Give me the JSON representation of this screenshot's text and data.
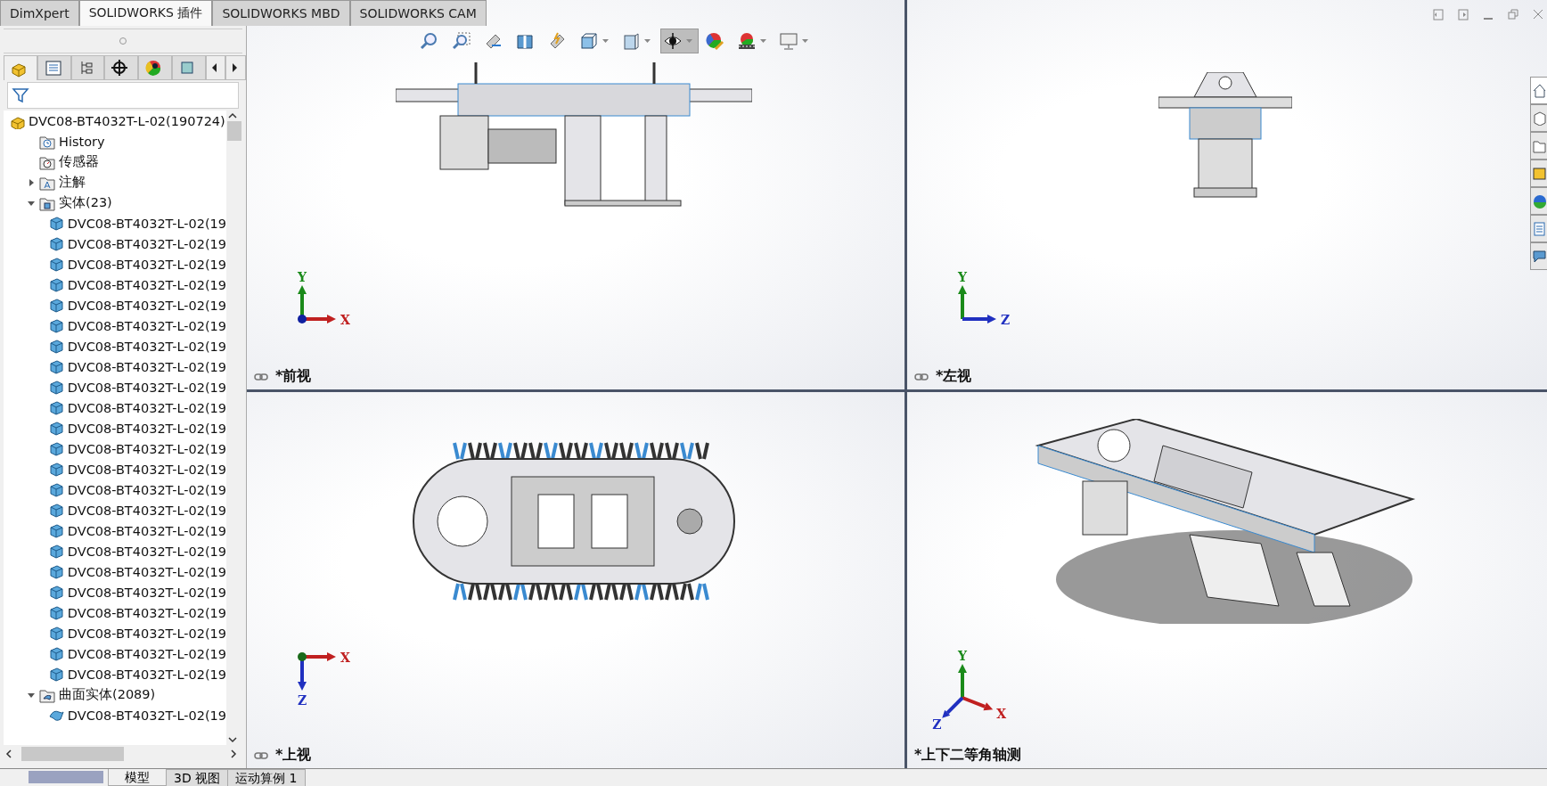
{
  "ribbon_tabs": [
    {
      "label": "DimXpert",
      "selected": false
    },
    {
      "label": "SOLIDWORKS 插件",
      "selected": true
    },
    {
      "label": "SOLIDWORKS MBD",
      "selected": false
    },
    {
      "label": "SOLIDWORKS CAM",
      "selected": false
    }
  ],
  "panel_tabs": [
    {
      "kind": "feature",
      "selected": true
    },
    {
      "kind": "property",
      "selected": false
    },
    {
      "kind": "config",
      "selected": false
    },
    {
      "kind": "dimxpert",
      "selected": false
    },
    {
      "kind": "appearance",
      "selected": false
    },
    {
      "kind": "cam",
      "selected": false
    }
  ],
  "tree": {
    "label": "DVC08-BT4032T-L-02(190724)",
    "children": [
      {
        "kind": "history",
        "label": "History"
      },
      {
        "kind": "sensor",
        "label": "传感器"
      },
      {
        "kind": "annotation",
        "label": "注解",
        "expanded": false
      },
      {
        "kind": "folder",
        "label": "实体(23)",
        "expanded": true,
        "children": [
          {
            "kind": "solid",
            "label": "DVC08-BT4032T-L-02(19"
          },
          {
            "kind": "solid",
            "label": "DVC08-BT4032T-L-02(19"
          },
          {
            "kind": "solid",
            "label": "DVC08-BT4032T-L-02(19"
          },
          {
            "kind": "solid",
            "label": "DVC08-BT4032T-L-02(19"
          },
          {
            "kind": "solid",
            "label": "DVC08-BT4032T-L-02(19"
          },
          {
            "kind": "solid",
            "label": "DVC08-BT4032T-L-02(19"
          },
          {
            "kind": "solid",
            "label": "DVC08-BT4032T-L-02(19"
          },
          {
            "kind": "solid",
            "label": "DVC08-BT4032T-L-02(19"
          },
          {
            "kind": "solid",
            "label": "DVC08-BT4032T-L-02(19"
          },
          {
            "kind": "solid",
            "label": "DVC08-BT4032T-L-02(19"
          },
          {
            "kind": "solid",
            "label": "DVC08-BT4032T-L-02(19"
          },
          {
            "kind": "solid",
            "label": "DVC08-BT4032T-L-02(19"
          },
          {
            "kind": "solid",
            "label": "DVC08-BT4032T-L-02(19"
          },
          {
            "kind": "solid",
            "label": "DVC08-BT4032T-L-02(19"
          },
          {
            "kind": "solid",
            "label": "DVC08-BT4032T-L-02(19"
          },
          {
            "kind": "solid",
            "label": "DVC08-BT4032T-L-02(19"
          },
          {
            "kind": "solid",
            "label": "DVC08-BT4032T-L-02(19"
          },
          {
            "kind": "solid",
            "label": "DVC08-BT4032T-L-02(19"
          },
          {
            "kind": "solid",
            "label": "DVC08-BT4032T-L-02(19"
          },
          {
            "kind": "solid",
            "label": "DVC08-BT4032T-L-02(19"
          },
          {
            "kind": "solid",
            "label": "DVC08-BT4032T-L-02(19"
          },
          {
            "kind": "solid",
            "label": "DVC08-BT4032T-L-02(19"
          },
          {
            "kind": "solid",
            "label": "DVC08-BT4032T-L-02(19"
          }
        ]
      },
      {
        "kind": "surface-folder",
        "label": "曲面实体(2089)",
        "expanded": true,
        "children": [
          {
            "kind": "surface",
            "label": "DVC08-BT4032T-L-02(19"
          }
        ]
      }
    ]
  },
  "toolbar": [
    {
      "kind": "zoom-fit",
      "dropdown": false,
      "selected": false
    },
    {
      "kind": "zoom-area",
      "dropdown": false,
      "selected": false
    },
    {
      "kind": "previous-view",
      "dropdown": false,
      "selected": false
    },
    {
      "kind": "section",
      "dropdown": false,
      "selected": false
    },
    {
      "kind": "dynamic",
      "dropdown": false,
      "selected": false
    },
    {
      "kind": "orientation",
      "dropdown": true,
      "selected": false
    },
    {
      "kind": "display-style",
      "dropdown": true,
      "selected": false
    },
    {
      "kind": "hide-show",
      "dropdown": true,
      "selected": true
    },
    {
      "kind": "edit-appearance",
      "dropdown": false,
      "selected": false
    },
    {
      "kind": "scene",
      "dropdown": true,
      "selected": false
    },
    {
      "kind": "view-settings",
      "dropdown": true,
      "selected": false
    }
  ],
  "task_pane": [
    {
      "kind": "home",
      "selected": true
    },
    {
      "kind": "parts",
      "selected": false
    },
    {
      "kind": "folder",
      "selected": false
    },
    {
      "kind": "library",
      "selected": false
    },
    {
      "kind": "appearance",
      "selected": false
    },
    {
      "kind": "properties",
      "selected": false
    },
    {
      "kind": "forum",
      "selected": false
    }
  ],
  "views": [
    {
      "kind": "front",
      "title": "*前视",
      "linked": true,
      "axes": [
        "Y",
        "X"
      ]
    },
    {
      "kind": "left",
      "title": "*左视",
      "linked": true,
      "axes": [
        "Y",
        "Z"
      ]
    },
    {
      "kind": "top",
      "title": "*上视",
      "linked": true,
      "axes": [
        "X",
        "Z"
      ]
    },
    {
      "kind": "iso",
      "title": "*上下二等角轴测",
      "linked": false,
      "axes": [
        "Y",
        "X",
        "Z"
      ]
    }
  ],
  "bottom_tabs": [
    {
      "label": "模型",
      "selected": true
    },
    {
      "label": "3D 视图",
      "selected": false
    },
    {
      "label": "运动算例 1",
      "selected": false
    }
  ]
}
